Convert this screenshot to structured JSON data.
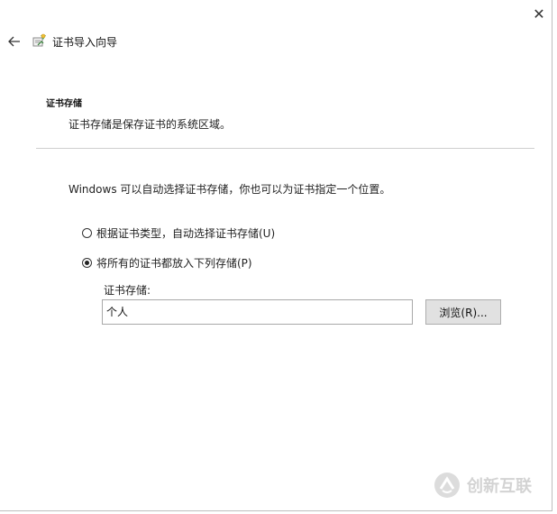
{
  "window": {
    "title": "证书导入向导",
    "close_glyph": "✕"
  },
  "section": {
    "heading": "证书存储",
    "description": "证书存储是保存证书的系统区域。"
  },
  "intro": "Windows 可以自动选择证书存储，你也可以为证书指定一个位置。",
  "options": [
    {
      "label": "根据证书类型，自动选择证书存储(U)",
      "selected": false
    },
    {
      "label": "将所有的证书都放入下列存储(P)",
      "selected": true
    }
  ],
  "store": {
    "label": "证书存储:",
    "value": "个人",
    "browse_label": "浏览(R)..."
  },
  "watermark": {
    "text": "创新互联"
  },
  "icons": {
    "back": "arrow-left-icon",
    "wizard": "certificate-icon",
    "close": "close-icon"
  }
}
